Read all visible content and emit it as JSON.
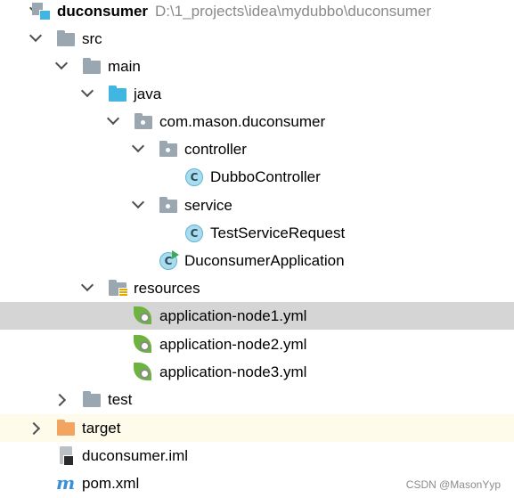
{
  "tree": {
    "root": {
      "name": "duconsumer",
      "path": "D:\\1_projects\\idea\\mydubbo\\duconsumer",
      "icon": "module-icon"
    },
    "src": {
      "name": "src",
      "icon": "folder-icon"
    },
    "main": {
      "name": "main",
      "icon": "folder-icon"
    },
    "java": {
      "name": "java",
      "icon": "source-folder-icon"
    },
    "package": {
      "name": "com.mason.duconsumer",
      "icon": "package-icon"
    },
    "controller": {
      "name": "controller",
      "icon": "package-icon"
    },
    "dubbo_controller": {
      "name": "DubboController",
      "icon": "class-icon",
      "glyph": "C"
    },
    "service": {
      "name": "service",
      "icon": "package-icon"
    },
    "test_service_request": {
      "name": "TestServiceRequest",
      "icon": "class-icon",
      "glyph": "C"
    },
    "app": {
      "name": "DuconsumerApplication",
      "icon": "runnable-class-icon",
      "glyph": "C"
    },
    "resources": {
      "name": "resources",
      "icon": "resources-folder-icon"
    },
    "yml1": {
      "name": "application-node1.yml",
      "icon": "spring-config-icon",
      "selected": true
    },
    "yml2": {
      "name": "application-node2.yml",
      "icon": "spring-config-icon"
    },
    "yml3": {
      "name": "application-node3.yml",
      "icon": "spring-config-icon"
    },
    "test": {
      "name": "test",
      "icon": "folder-icon"
    },
    "target": {
      "name": "target",
      "icon": "excluded-folder-icon"
    },
    "iml": {
      "name": "duconsumer.iml",
      "icon": "iml-file-icon"
    },
    "pom": {
      "name": "pom.xml",
      "icon": "maven-icon",
      "glyph": "m"
    }
  },
  "watermark": "CSDN @MasonYyp",
  "colors": {
    "selection": "#d5d5d5",
    "excluded_row": "#fefbea",
    "folder": "#9aa7b0",
    "source_folder": "#40b6e0",
    "excluded_folder": "#f4a461",
    "spring": "#6db33f",
    "path_text": "#8a8a8a"
  }
}
